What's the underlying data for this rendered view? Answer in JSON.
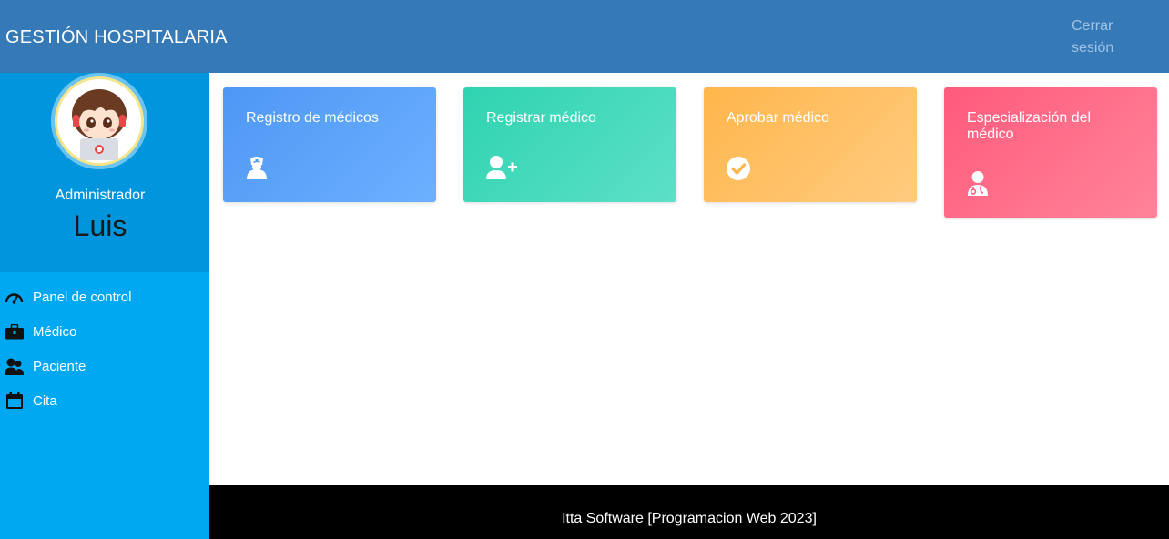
{
  "header": {
    "title": "GESTIÓN HOSPITALARIA",
    "logout_label": "Cerrar sesión"
  },
  "sidebar": {
    "role": "Administrador",
    "username": "Luis",
    "items": [
      {
        "label": "Panel de control",
        "icon": "gauge-icon"
      },
      {
        "label": "Médico",
        "icon": "briefcase-icon"
      },
      {
        "label": "Paciente",
        "icon": "users-icon"
      },
      {
        "label": "Cita",
        "icon": "calendar-icon"
      }
    ]
  },
  "cards": [
    {
      "title": "Registro de médicos",
      "icon": "doctor-icon",
      "color": "#4e97f4"
    },
    {
      "title": "Registrar médico",
      "icon": "user-plus-icon",
      "color": "#2fd3b1"
    },
    {
      "title": "Aprobar médico",
      "icon": "check-circle-icon",
      "color": "#ffb64c"
    },
    {
      "title": "Especialización del médico",
      "icon": "user-doctor-icon",
      "color": "#ff5a7c"
    }
  ],
  "footer": {
    "text": "Itta Software [Programacion Web 2023]"
  },
  "colors": {
    "header": "#3579b6",
    "sidebar": "#00a8f2",
    "profile": "#0095dc",
    "footer": "#000000"
  }
}
